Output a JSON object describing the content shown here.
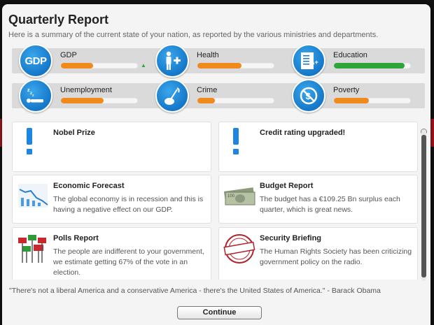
{
  "header": {
    "title": "Quarterly Report",
    "subtitle": "Here is a summary of the current state of your nation, as reported by the various ministries and departments."
  },
  "stats": [
    {
      "label": "GDP",
      "icon": "gdp-icon",
      "icon_text": "GDP",
      "level": 0.42,
      "color": "#f08a1c",
      "trend": "up"
    },
    {
      "label": "Health",
      "icon": "health-icon",
      "level": 0.57,
      "color": "#f08a1c"
    },
    {
      "label": "Education",
      "icon": "education-icon",
      "level": 0.92,
      "color": "#2ea53a"
    },
    {
      "label": "Unemployment",
      "icon": "unemployment-icon",
      "level": 0.55,
      "color": "#f08a1c"
    },
    {
      "label": "Crime",
      "icon": "crime-icon",
      "level": 0.23,
      "color": "#f08a1c"
    },
    {
      "label": "Poverty",
      "icon": "poverty-icon",
      "level": 0.45,
      "color": "#f08a1c"
    }
  ],
  "cards": [
    {
      "title": "Nobel Prize",
      "body": "",
      "icon": "exclamation-icon"
    },
    {
      "title": "Credit rating upgraded!",
      "body": "",
      "icon": "exclamation-icon"
    },
    {
      "title": "Economic Forecast",
      "body": "The global economy is in recession and this is having a negative effect on our GDP.",
      "icon": "chart-icon"
    },
    {
      "title": "Budget Report",
      "body": "The budget has a €109.25 Bn surplus each quarter, which is great news.",
      "icon": "money-icon"
    },
    {
      "title": "Polls Report",
      "body": "The people are indifferent to your government, we estimate getting 67% of the vote in an election.",
      "icon": "poll-signs-icon"
    },
    {
      "title": "Security Briefing",
      "body": "The Human Rights Society has been criticizing government policy on the radio.",
      "icon": "classified-stamp-icon"
    }
  ],
  "quote": "\"There's not a liberal America and a conservative America - there's the United States of America.\" - Barack Obama",
  "continue_label": "Continue",
  "colors": {
    "accent": "#1c86e0",
    "warning": "#f08a1c",
    "good": "#2ea53a"
  }
}
